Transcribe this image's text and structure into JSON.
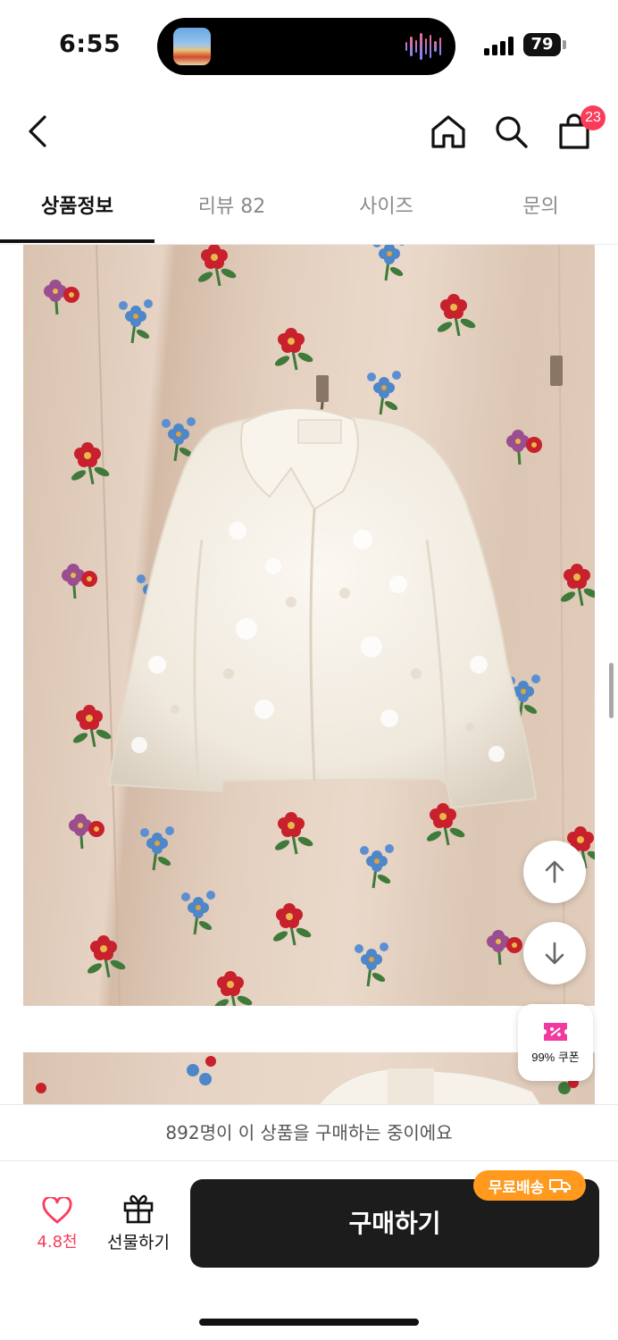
{
  "status_bar": {
    "time": "6:55",
    "battery": "79"
  },
  "nav": {
    "cart_badge": "23"
  },
  "tabs": [
    {
      "label": "상품정보",
      "active": true
    },
    {
      "label": "리뷰 82",
      "active": false
    },
    {
      "label": "사이즈",
      "active": false
    },
    {
      "label": "문의",
      "active": false
    }
  ],
  "coupon": {
    "label": "99% 쿠폰"
  },
  "purchase_notice": "892명이 이 상품을 구매하는 중이에요",
  "bottom_bar": {
    "like_count": "4.8천",
    "gift_label": "선물하기",
    "buy_label": "구매하기",
    "free_shipping": "무료배송"
  },
  "colors": {
    "accent_red": "#fa3c5a",
    "shipping_orange": "#ff9a1f",
    "buy_button": "#1c1c1c"
  }
}
